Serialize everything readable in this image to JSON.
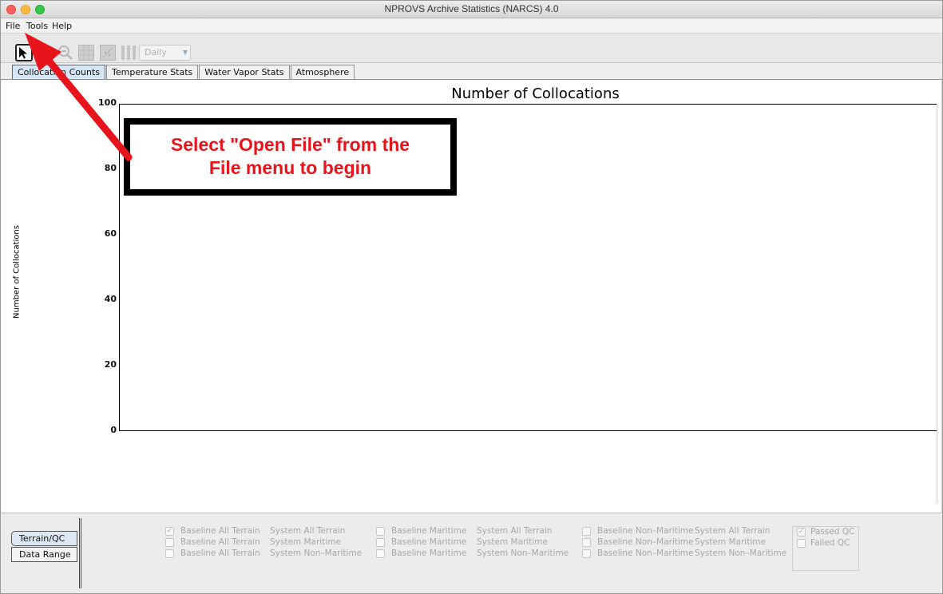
{
  "window": {
    "title": "NPROVS Archive Statistics (NARCS) 4.0"
  },
  "menu": {
    "file": "File",
    "tools": "Tools",
    "help": "Help"
  },
  "toolbar": {
    "period_value": "Daily"
  },
  "tabs": [
    {
      "label": "Collocation Counts",
      "active": true
    },
    {
      "label": "Temperature Stats",
      "active": false
    },
    {
      "label": "Water Vapor Stats",
      "active": false
    },
    {
      "label": "Atmosphere",
      "active": false
    }
  ],
  "chart_data": {
    "type": "bar",
    "title": "Number of Collocations",
    "xlabel": "",
    "ylabel": "Number of Collocations",
    "ylim": [
      0,
      100
    ],
    "yticks": [
      "100",
      "80",
      "60",
      "40",
      "20",
      "0"
    ],
    "categories": [],
    "values": []
  },
  "callout": {
    "line1": "Select \"Open File\" from the",
    "line2": "File menu to begin"
  },
  "side_tabs": [
    {
      "label": "Terrain/QC",
      "active": true
    },
    {
      "label": "Data Range",
      "active": false
    }
  ],
  "checkboxes": {
    "col1": [
      {
        "a": "Baseline All Terrain",
        "b": "System All Terrain",
        "checked": true
      },
      {
        "a": "Baseline All Terrain",
        "b": "System Maritime",
        "checked": false
      },
      {
        "a": "Baseline All Terrain",
        "b": "System Non–Maritime",
        "checked": false
      }
    ],
    "col2": [
      {
        "a": "Baseline Maritime",
        "b": "System All Terrain",
        "checked": false
      },
      {
        "a": "Baseline Maritime",
        "b": "System Maritime",
        "checked": false
      },
      {
        "a": "Baseline Maritime",
        "b": "System Non–Maritime",
        "checked": false
      }
    ],
    "col3": [
      {
        "a": "Baseline Non–Maritime",
        "b": "System All Terrain",
        "checked": false
      },
      {
        "a": "Baseline Non–Maritime",
        "b": "System Maritime",
        "checked": false
      },
      {
        "a": "Baseline Non–Maritime",
        "b": "System Non–Maritime",
        "checked": false
      }
    ],
    "qc": [
      {
        "label": "Passed QC",
        "checked": true
      },
      {
        "label": "Failed QC",
        "checked": false
      }
    ]
  },
  "colors": {
    "annotation": "#e8141c",
    "active_tab": "#d7e6f7"
  }
}
